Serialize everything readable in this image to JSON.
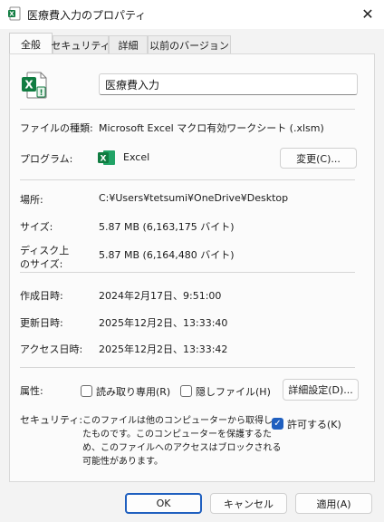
{
  "window": {
    "title": "医療費入力のプロパティ",
    "close_glyph": "✕"
  },
  "tabs": [
    {
      "label": "全般",
      "active": true
    },
    {
      "label": "セキュリティ"
    },
    {
      "label": "詳細"
    },
    {
      "label": "以前のバージョン"
    }
  ],
  "general": {
    "file_name": "医療費入力",
    "file_type_label": "ファイルの種類:",
    "file_type_value": "Microsoft Excel マクロ有効ワークシート (.xlsm)",
    "program_label": "プログラム:",
    "program_value": "Excel",
    "change_button": "変更(C)...",
    "location_label": "場所:",
    "location_value": "C:¥Users¥tetsumi¥OneDrive¥Desktop",
    "size_label": "サイズ:",
    "size_value": "5.87 MB (6,163,175 バイト)",
    "size_on_disk_label_1": "ディスク上",
    "size_on_disk_label_2": "のサイズ:",
    "size_on_disk_value": "5.87 MB (6,164,480 バイト)",
    "created_label": "作成日時:",
    "created_value": "2024年2月17日、9:51:00",
    "modified_label": "更新日時:",
    "modified_value": "2025年12月2日、13:33:40",
    "accessed_label": "アクセス日時:",
    "accessed_value": "2025年12月2日、13:33:42",
    "attributes_label": "属性:",
    "readonly_label": "読み取り専用(R)",
    "readonly_checked": false,
    "hidden_label": "隠しファイル(H)",
    "hidden_checked": false,
    "advanced_button": "詳細設定(D)...",
    "security_label": "セキュリティ:",
    "security_text_1": "このファイルは他のコンピューターから取得し",
    "security_text_2": "たものです。このコンピューターを保護するた",
    "security_text_3": "め、このファイルへのアクセスはブロックされる",
    "security_text_4": "可能性があります。",
    "unblock_label": "許可する(K)",
    "unblock_checked": true
  },
  "footer": {
    "ok": "OK",
    "cancel": "キャンセル",
    "apply": "適用(A)"
  },
  "colors": {
    "excel_green": "#107c41",
    "accent": "#1f5fbf"
  }
}
